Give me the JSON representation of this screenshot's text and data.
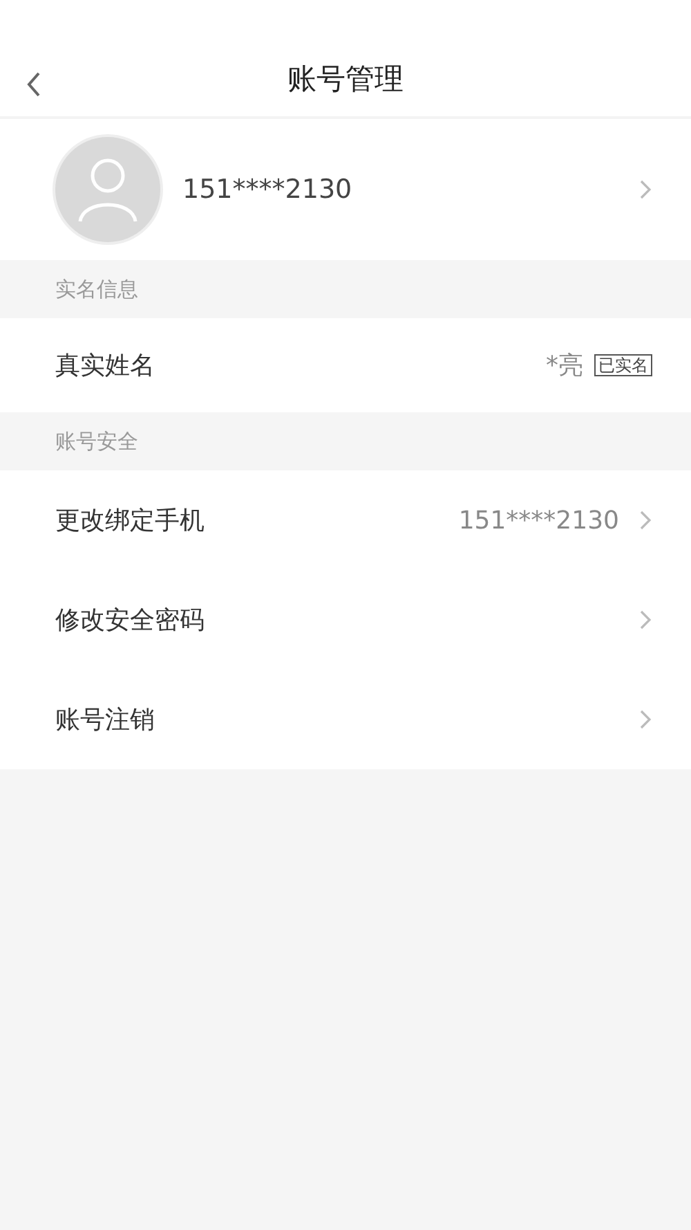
{
  "nav": {
    "title": "账号管理"
  },
  "profile": {
    "phone": "151****2130"
  },
  "sections": [
    {
      "header": "实名信息",
      "rows": [
        {
          "label": "真实姓名",
          "value": "*亮",
          "badge": "已实名",
          "arrow": false
        }
      ]
    },
    {
      "header": "账号安全",
      "rows": [
        {
          "label": "更改绑定手机",
          "value": "151****2130",
          "arrow": true
        },
        {
          "label": "修改安全密码",
          "arrow": true
        },
        {
          "label": "账号注销",
          "arrow": true
        }
      ]
    }
  ]
}
